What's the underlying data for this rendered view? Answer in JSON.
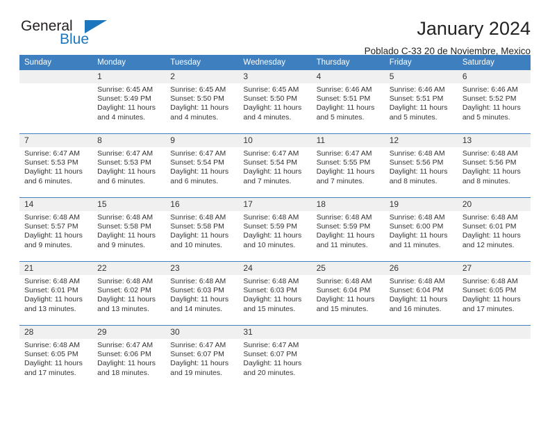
{
  "brand": {
    "name_top": "General",
    "name_bottom": "Blue",
    "accent_color": "#1b76bd"
  },
  "header": {
    "title": "January 2024",
    "subtitle": "Poblado C-33 20 de Noviembre, Mexico"
  },
  "calendar": {
    "header_bg": "#3d7fbf",
    "daynum_bg": "#f0f0f0",
    "weekday_headers": [
      "Sunday",
      "Monday",
      "Tuesday",
      "Wednesday",
      "Thursday",
      "Friday",
      "Saturday"
    ],
    "weeks": [
      [
        {
          "day": "",
          "sunrise": "",
          "sunset": "",
          "daylight": ""
        },
        {
          "day": "1",
          "sunrise": "Sunrise: 6:45 AM",
          "sunset": "Sunset: 5:49 PM",
          "daylight": "Daylight: 11 hours and 4 minutes."
        },
        {
          "day": "2",
          "sunrise": "Sunrise: 6:45 AM",
          "sunset": "Sunset: 5:50 PM",
          "daylight": "Daylight: 11 hours and 4 minutes."
        },
        {
          "day": "3",
          "sunrise": "Sunrise: 6:45 AM",
          "sunset": "Sunset: 5:50 PM",
          "daylight": "Daylight: 11 hours and 4 minutes."
        },
        {
          "day": "4",
          "sunrise": "Sunrise: 6:46 AM",
          "sunset": "Sunset: 5:51 PM",
          "daylight": "Daylight: 11 hours and 5 minutes."
        },
        {
          "day": "5",
          "sunrise": "Sunrise: 6:46 AM",
          "sunset": "Sunset: 5:51 PM",
          "daylight": "Daylight: 11 hours and 5 minutes."
        },
        {
          "day": "6",
          "sunrise": "Sunrise: 6:46 AM",
          "sunset": "Sunset: 5:52 PM",
          "daylight": "Daylight: 11 hours and 5 minutes."
        }
      ],
      [
        {
          "day": "7",
          "sunrise": "Sunrise: 6:47 AM",
          "sunset": "Sunset: 5:53 PM",
          "daylight": "Daylight: 11 hours and 6 minutes."
        },
        {
          "day": "8",
          "sunrise": "Sunrise: 6:47 AM",
          "sunset": "Sunset: 5:53 PM",
          "daylight": "Daylight: 11 hours and 6 minutes."
        },
        {
          "day": "9",
          "sunrise": "Sunrise: 6:47 AM",
          "sunset": "Sunset: 5:54 PM",
          "daylight": "Daylight: 11 hours and 6 minutes."
        },
        {
          "day": "10",
          "sunrise": "Sunrise: 6:47 AM",
          "sunset": "Sunset: 5:54 PM",
          "daylight": "Daylight: 11 hours and 7 minutes."
        },
        {
          "day": "11",
          "sunrise": "Sunrise: 6:47 AM",
          "sunset": "Sunset: 5:55 PM",
          "daylight": "Daylight: 11 hours and 7 minutes."
        },
        {
          "day": "12",
          "sunrise": "Sunrise: 6:48 AM",
          "sunset": "Sunset: 5:56 PM",
          "daylight": "Daylight: 11 hours and 8 minutes."
        },
        {
          "day": "13",
          "sunrise": "Sunrise: 6:48 AM",
          "sunset": "Sunset: 5:56 PM",
          "daylight": "Daylight: 11 hours and 8 minutes."
        }
      ],
      [
        {
          "day": "14",
          "sunrise": "Sunrise: 6:48 AM",
          "sunset": "Sunset: 5:57 PM",
          "daylight": "Daylight: 11 hours and 9 minutes."
        },
        {
          "day": "15",
          "sunrise": "Sunrise: 6:48 AM",
          "sunset": "Sunset: 5:58 PM",
          "daylight": "Daylight: 11 hours and 9 minutes."
        },
        {
          "day": "16",
          "sunrise": "Sunrise: 6:48 AM",
          "sunset": "Sunset: 5:58 PM",
          "daylight": "Daylight: 11 hours and 10 minutes."
        },
        {
          "day": "17",
          "sunrise": "Sunrise: 6:48 AM",
          "sunset": "Sunset: 5:59 PM",
          "daylight": "Daylight: 11 hours and 10 minutes."
        },
        {
          "day": "18",
          "sunrise": "Sunrise: 6:48 AM",
          "sunset": "Sunset: 5:59 PM",
          "daylight": "Daylight: 11 hours and 11 minutes."
        },
        {
          "day": "19",
          "sunrise": "Sunrise: 6:48 AM",
          "sunset": "Sunset: 6:00 PM",
          "daylight": "Daylight: 11 hours and 11 minutes."
        },
        {
          "day": "20",
          "sunrise": "Sunrise: 6:48 AM",
          "sunset": "Sunset: 6:01 PM",
          "daylight": "Daylight: 11 hours and 12 minutes."
        }
      ],
      [
        {
          "day": "21",
          "sunrise": "Sunrise: 6:48 AM",
          "sunset": "Sunset: 6:01 PM",
          "daylight": "Daylight: 11 hours and 13 minutes."
        },
        {
          "day": "22",
          "sunrise": "Sunrise: 6:48 AM",
          "sunset": "Sunset: 6:02 PM",
          "daylight": "Daylight: 11 hours and 13 minutes."
        },
        {
          "day": "23",
          "sunrise": "Sunrise: 6:48 AM",
          "sunset": "Sunset: 6:03 PM",
          "daylight": "Daylight: 11 hours and 14 minutes."
        },
        {
          "day": "24",
          "sunrise": "Sunrise: 6:48 AM",
          "sunset": "Sunset: 6:03 PM",
          "daylight": "Daylight: 11 hours and 15 minutes."
        },
        {
          "day": "25",
          "sunrise": "Sunrise: 6:48 AM",
          "sunset": "Sunset: 6:04 PM",
          "daylight": "Daylight: 11 hours and 15 minutes."
        },
        {
          "day": "26",
          "sunrise": "Sunrise: 6:48 AM",
          "sunset": "Sunset: 6:04 PM",
          "daylight": "Daylight: 11 hours and 16 minutes."
        },
        {
          "day": "27",
          "sunrise": "Sunrise: 6:48 AM",
          "sunset": "Sunset: 6:05 PM",
          "daylight": "Daylight: 11 hours and 17 minutes."
        }
      ],
      [
        {
          "day": "28",
          "sunrise": "Sunrise: 6:48 AM",
          "sunset": "Sunset: 6:05 PM",
          "daylight": "Daylight: 11 hours and 17 minutes."
        },
        {
          "day": "29",
          "sunrise": "Sunrise: 6:47 AM",
          "sunset": "Sunset: 6:06 PM",
          "daylight": "Daylight: 11 hours and 18 minutes."
        },
        {
          "day": "30",
          "sunrise": "Sunrise: 6:47 AM",
          "sunset": "Sunset: 6:07 PM",
          "daylight": "Daylight: 11 hours and 19 minutes."
        },
        {
          "day": "31",
          "sunrise": "Sunrise: 6:47 AM",
          "sunset": "Sunset: 6:07 PM",
          "daylight": "Daylight: 11 hours and 20 minutes."
        },
        {
          "day": "",
          "sunrise": "",
          "sunset": "",
          "daylight": ""
        },
        {
          "day": "",
          "sunrise": "",
          "sunset": "",
          "daylight": ""
        },
        {
          "day": "",
          "sunrise": "",
          "sunset": "",
          "daylight": ""
        }
      ]
    ]
  }
}
